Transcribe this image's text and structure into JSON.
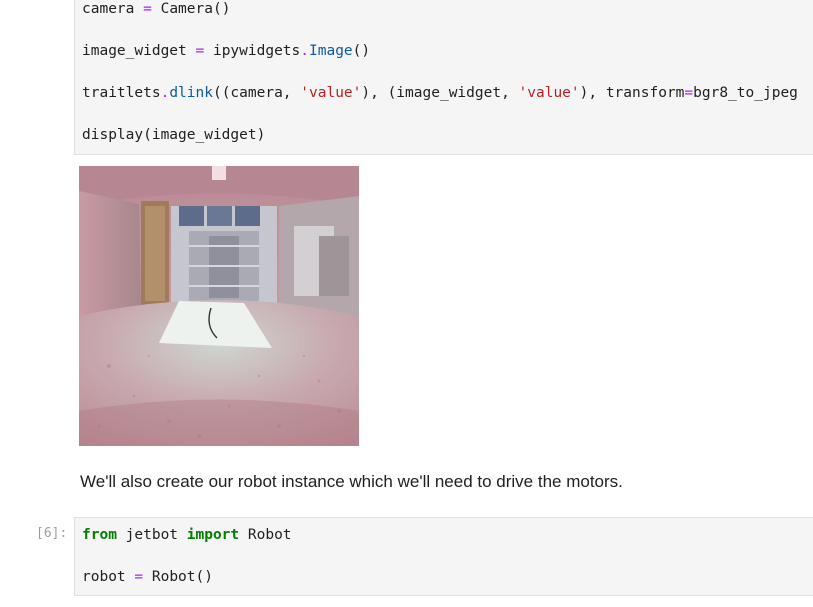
{
  "cell_top": {
    "line1": {
      "var": "camera",
      "op": "=",
      "call": "Camera()"
    },
    "line2": {
      "var": "image_widget",
      "op": "=",
      "module": "ipywidgets",
      "dot": ".",
      "attr": "Image",
      "parens": "()"
    },
    "line3": {
      "p1": "traitlets",
      "dot": ".",
      "attr": "dlink",
      "p2": "((camera, ",
      "s1": "'value'",
      "p3": "), (image_widget, ",
      "s2": "'value'",
      "p4": "), transform",
      "op": "=",
      "p5": "bgr8_to_jpeg"
    },
    "line4": {
      "text": "display(image_widget)"
    }
  },
  "output_image": {
    "icon": "camera-feed-image"
  },
  "markdown": {
    "text": "We'll also create our robot instance which we'll need to drive the motors."
  },
  "cell_bottom": {
    "prompt": "[6]:",
    "line1": {
      "kw1": "from",
      "mod": " jetbot ",
      "kw2": "import",
      "name": " Robot"
    },
    "line2": {
      "var": "robot",
      "op": "=",
      "call": "Robot()"
    }
  }
}
